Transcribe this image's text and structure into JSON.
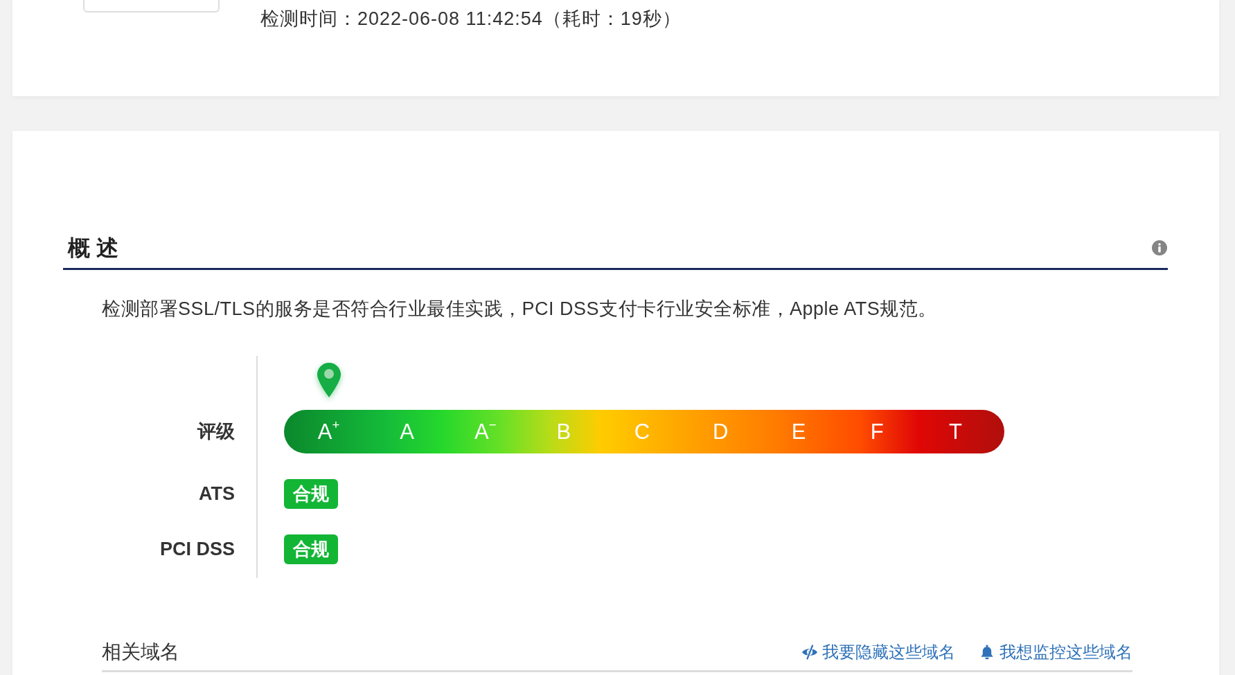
{
  "header": {
    "check_time": "检测时间：2022-06-08 11:42:54（耗时：19秒）"
  },
  "overview": {
    "title": "概 述",
    "description": "检测部署SSL/TLS的服务是否符合行业最佳实践，PCI DSS支付卡行业安全标准，Apple ATS规范。",
    "rating": {
      "label": "评级",
      "grades": [
        {
          "label": "A$^{+}$",
          "selected": true
        },
        {
          "label": "A",
          "selected": false
        },
        {
          "label": "A$^{−}$",
          "selected": false
        },
        {
          "label": "B",
          "selected": false
        },
        {
          "label": "C",
          "selected": false
        },
        {
          "label": "D",
          "selected": false
        },
        {
          "label": "E",
          "selected": false
        },
        {
          "label": "F",
          "selected": false
        },
        {
          "label": "T",
          "selected": false
        }
      ]
    },
    "compliance": [
      {
        "label": "ATS",
        "badge": "合规",
        "compliant": true
      },
      {
        "label": "PCI DSS",
        "badge": "合规",
        "compliant": true
      }
    ]
  },
  "related_domains": {
    "title": "相关域名",
    "links": [
      {
        "kind": "hide",
        "label": "我要隐藏这些域名"
      },
      {
        "kind": "monitor",
        "label": "我想监控这些域名"
      }
    ]
  }
}
